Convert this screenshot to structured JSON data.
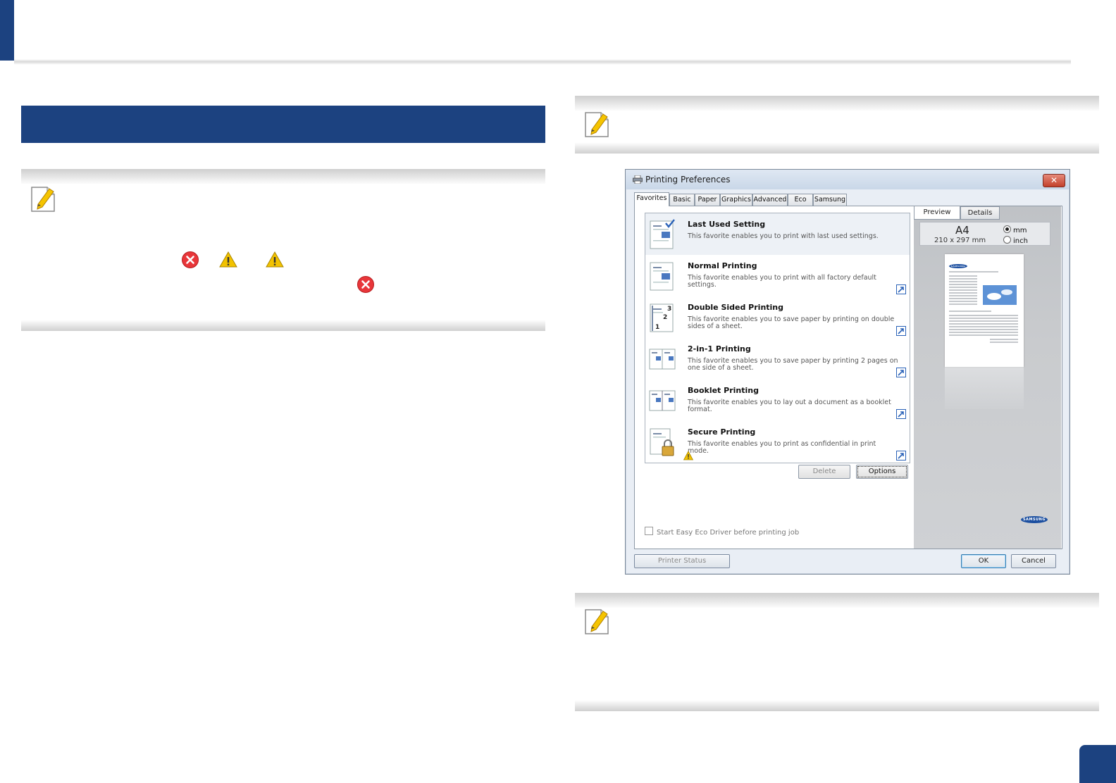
{
  "dialog": {
    "title": "Printing Preferences",
    "close_glyph": "✕",
    "tabs": [
      "Favorites",
      "Basic",
      "Paper",
      "Graphics",
      "Advanced",
      "Eco",
      "Samsung"
    ],
    "favorites": [
      {
        "title": "Last Used Setting",
        "desc": "This favorite enables you to print with last used settings."
      },
      {
        "title": "Normal Printing",
        "desc": "This favorite enables you to print with all factory default settings."
      },
      {
        "title": "Double Sided Printing",
        "desc": "This favorite enables you to save paper by printing on double sides of a sheet."
      },
      {
        "title": "2-in-1 Printing",
        "desc": "This favorite enables you to save paper by printing 2 pages on one side of a sheet."
      },
      {
        "title": "Booklet Printing",
        "desc": "This favorite enables you to lay out a document as a booklet format."
      },
      {
        "title": "Secure Printing",
        "desc": "This favorite enables you to print as confidential in print mode."
      }
    ],
    "delete_label": "Delete",
    "options_label": "Options",
    "eco_checkbox_label": "Start Easy Eco Driver before printing job",
    "preview_tab": "Preview",
    "details_tab": "Details",
    "paper_size": "A4",
    "paper_dimensions": "210 x 297 mm",
    "unit_mm": "mm",
    "unit_inch": "inch",
    "brand": "SAMSUNG",
    "printer_status_label": "Printer Status",
    "ok_label": "OK",
    "cancel_label": "Cancel"
  },
  "colors": {
    "accent": "#1c4280",
    "error_red": "#e8363a",
    "warning_yellow": "#f2c200"
  }
}
